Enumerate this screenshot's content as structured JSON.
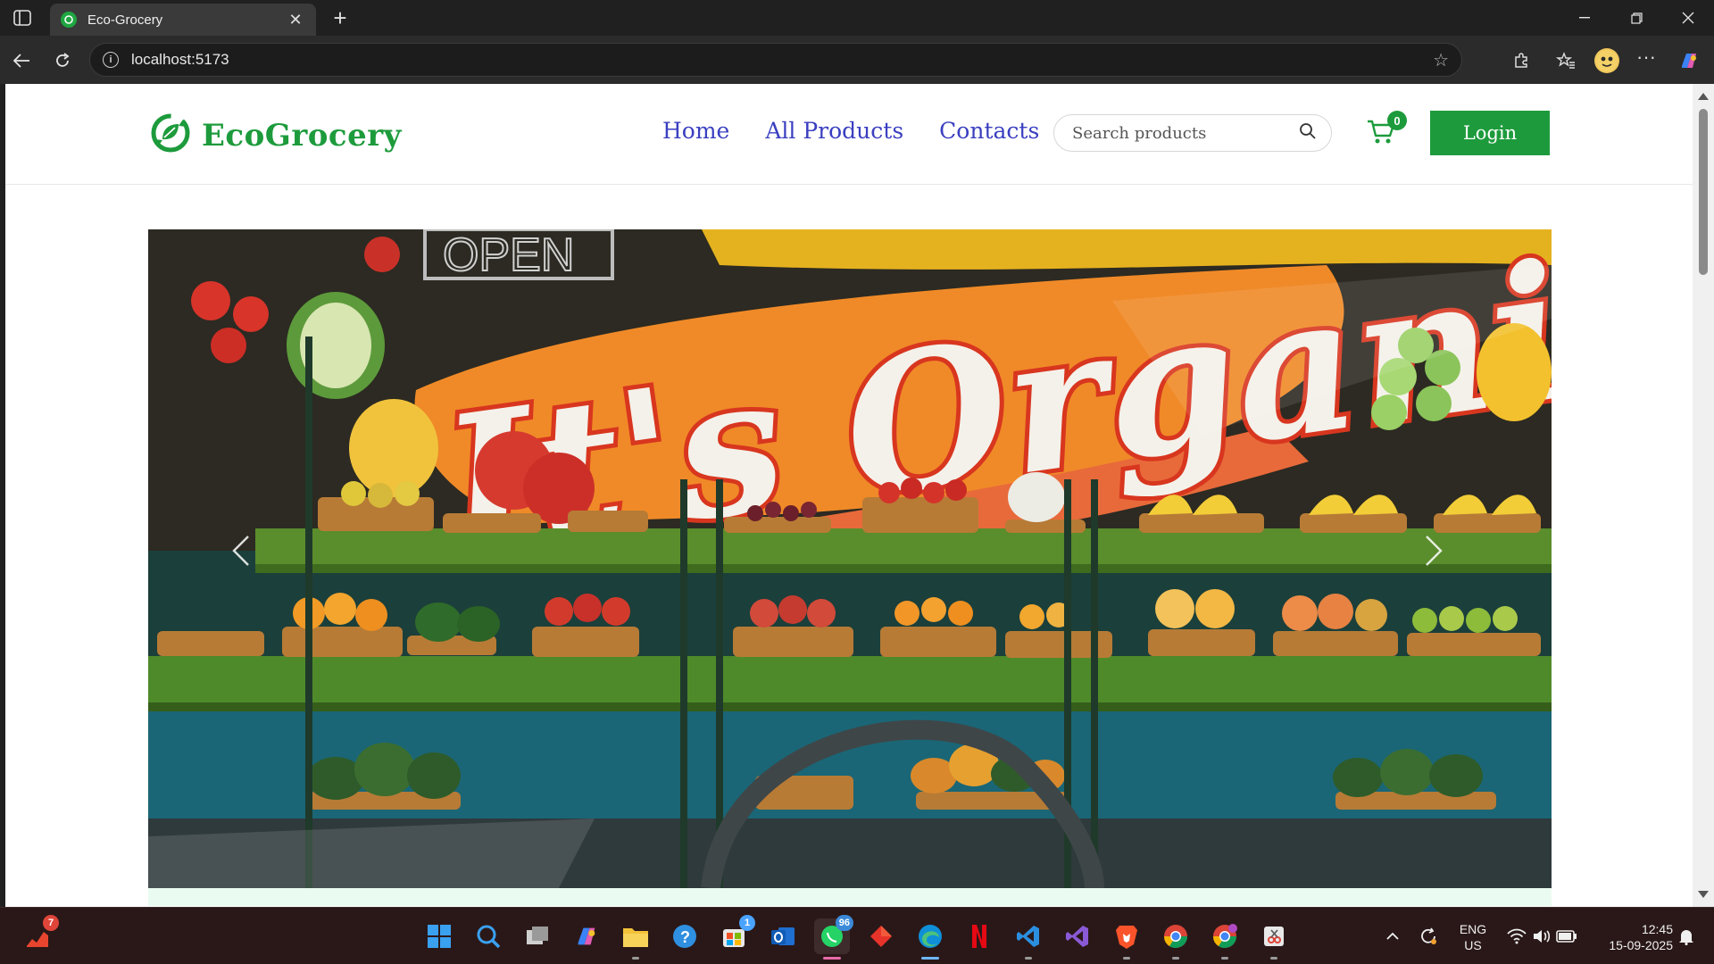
{
  "browser": {
    "tab_title": "Eco-Grocery",
    "url": "localhost:5173",
    "new_tab_symbol": "+",
    "tab_close_symbol": "✕"
  },
  "header": {
    "logo_text": "EcoGrocery",
    "nav": [
      {
        "label": "Home"
      },
      {
        "label": "All Products"
      },
      {
        "label": "Contacts"
      }
    ],
    "search_placeholder": "Search products",
    "cart_count": "0",
    "login_label": "Login"
  },
  "hero": {
    "sign_text": "It's Organic!",
    "open_sign": "OPEN"
  },
  "taskbar": {
    "notif_badge": "7",
    "whatsapp_badge": "96",
    "store_badge": "1",
    "lang_line1": "ENG",
    "lang_line2": "US",
    "time": "12:45",
    "date": "15-09-2025"
  },
  "colors": {
    "brand_green": "#1d9b3c",
    "nav_blue": "#3a3fc0"
  }
}
